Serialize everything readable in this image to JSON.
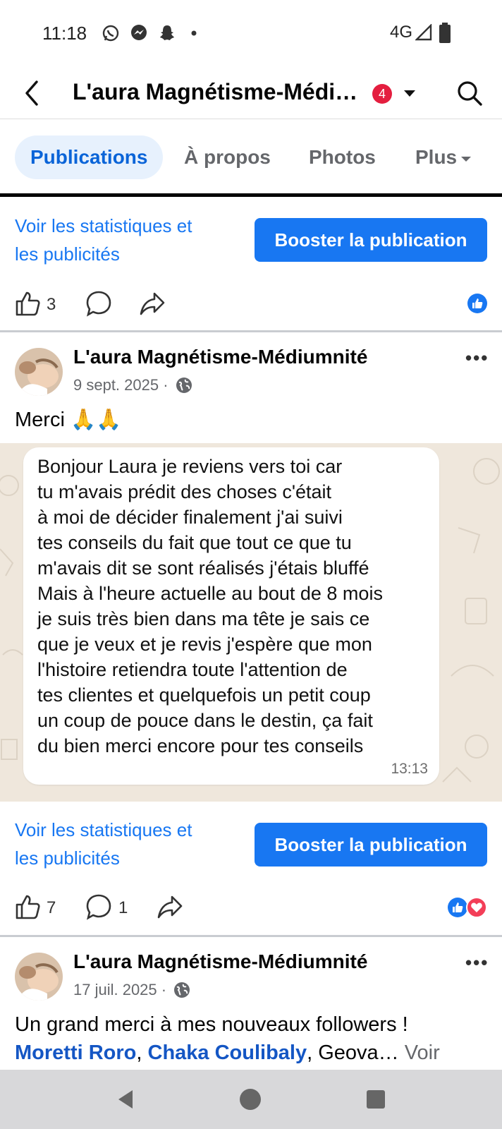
{
  "status_bar": {
    "time": "11:18",
    "network": "4G"
  },
  "header": {
    "title": "L'aura Magnétisme-Médi…",
    "badge": "4"
  },
  "tabs": [
    {
      "label": "Publications",
      "active": true
    },
    {
      "label": "À propos"
    },
    {
      "label": "Photos"
    },
    {
      "label": "Plus"
    }
  ],
  "stats": {
    "link_line1": "Voir les statistiques et",
    "link_line2": "les publicités",
    "boost_label": "Booster la publication"
  },
  "post0": {
    "likes": "3"
  },
  "post1": {
    "author": "L'aura Magnétisme-Médiumnité",
    "date": "9 sept. 2025 ·",
    "text": "Merci 🙏🙏",
    "message_lines": [
      "Bonjour Laura je reviens vers toi car",
      "tu m'avais prédit des choses c'était",
      "à moi de décider finalement j'ai suivi",
      "tes conseils du fait que tout ce que tu",
      "m'avais dit se sont réalisés j'étais bluffé",
      "Mais à l'heure actuelle au bout de 8 mois",
      "je suis très bien dans ma tête je sais ce",
      "que je veux et je revis j'espère que mon",
      "l'histoire retiendra toute l'attention de",
      "tes clientes et quelquefois un petit coup",
      "un  coup de pouce dans le destin, ça fait",
      "du bien merci encore pour tes conseils"
    ],
    "message_time": "13:13",
    "likes": "7",
    "comments": "1"
  },
  "post2": {
    "author": "L'aura Magnétisme-Médiumnité",
    "date": "17 juil. 2025 ·",
    "text": "Un grand merci à mes nouveaux followers !",
    "tag1": "Moretti Roro",
    "comma1": ", ",
    "tag2": "Chaka Coulibaly",
    "rest": ", Geova…",
    "see_more": "Voir"
  },
  "colors": {
    "brand_blue": "#1877f2",
    "badge_red": "#e41e3f"
  },
  "icons": [
    "whatsapp-icon",
    "messenger-icon",
    "snapchat-icon",
    "signal-icon",
    "battery-icon",
    "back-arrow-icon",
    "search-icon",
    "like-icon",
    "comment-icon",
    "share-icon",
    "globe-icon",
    "more-icon"
  ]
}
